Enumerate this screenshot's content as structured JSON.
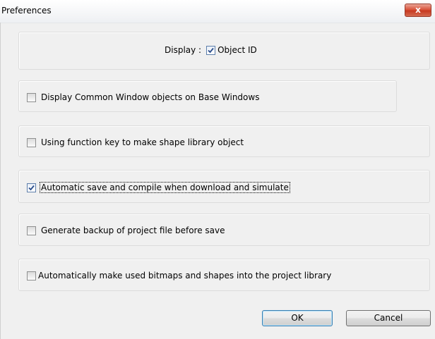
{
  "window": {
    "title": "Preferences",
    "close_label": "x"
  },
  "display": {
    "label": "Display :",
    "checkbox_label": "Object ID",
    "checked": true
  },
  "options": [
    {
      "label": "Display Common Window objects on Base Windows",
      "checked": false
    },
    {
      "label": "Using function key to make shape library object",
      "checked": false
    },
    {
      "label": "Automatic save and compile when download and simulate",
      "checked": true
    },
    {
      "label": "Generate backup of project file before save",
      "checked": false
    },
    {
      "label": "Automatically make used bitmaps and shapes into the project library",
      "checked": false
    }
  ],
  "buttons": {
    "ok_label": "OK",
    "cancel_label": "Cancel"
  }
}
